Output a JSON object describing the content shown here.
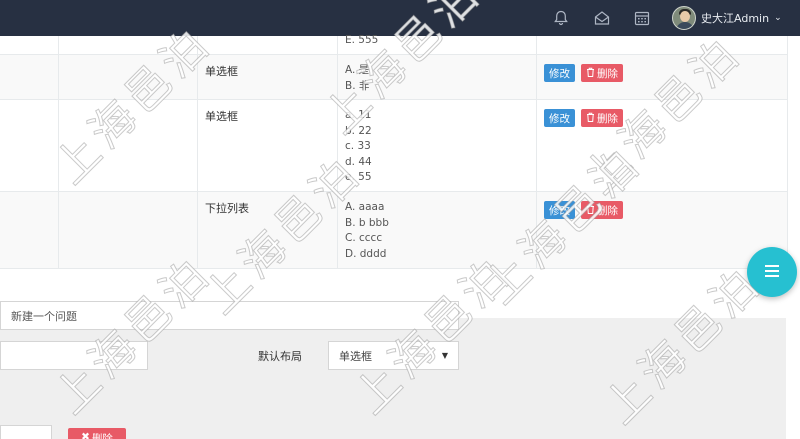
{
  "header": {
    "user_name": "史大江Admin",
    "icons": [
      "bell-icon",
      "envelope-open-icon",
      "calendar-icon",
      "chevron-down-icon"
    ]
  },
  "table": {
    "rows": [
      {
        "type": "",
        "options": [
          "E. 555"
        ]
      },
      {
        "type": "单选框",
        "options": [
          "A. 是",
          "B. 非"
        ]
      },
      {
        "type": "单选框",
        "options": [
          "a. 11",
          "b. 22",
          "c. 33",
          "d. 44",
          "e. 55"
        ]
      },
      {
        "type": "下拉列表",
        "options": [
          "A. aaaa",
          "B. b bbb",
          "C. cccc",
          "D. dddd"
        ]
      }
    ],
    "edit_label": "修改",
    "delete_label": "删除"
  },
  "form": {
    "question_value": "新建一个问题",
    "layout_label": "默认布局",
    "layout_selected": "单选框",
    "delete_label": "删除"
  },
  "watermark": "上海邑泊",
  "colors": {
    "header_bg": "#273042",
    "edit_button": "#3a91d6",
    "delete_button": "#e85a66",
    "fab": "#26c0d1",
    "panel_bg": "#efefef"
  }
}
